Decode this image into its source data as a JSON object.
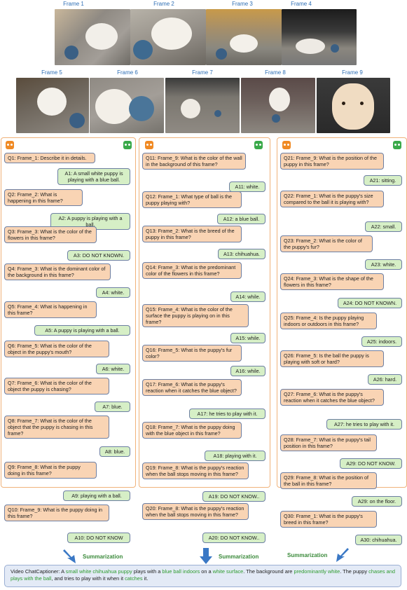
{
  "frames_top": [
    "Frame 1",
    "Frame 2",
    "Frame 3",
    "Frame 4"
  ],
  "frames_bottom": [
    "Frame 5",
    "Frame 6",
    "Frame 7",
    "Frame 8",
    "Frame 9"
  ],
  "col1": {
    "q": [
      "Q1: Frame_1: Describe it in details.",
      "Q2: Frame_2: What is happening in this frame?",
      "Q3: Frame_3: What is the color of the flowers in this frame?",
      "Q4: Frame_3: What is the dominant color of the background in this frame?",
      "Q5: Frame_4: What is happening in this frame?",
      "Q6: Frame_5: What is the color of the object in the puppy's mouth?",
      "Q7: Frame_6: What is the color of the object the puppy is chasing?",
      "Q8: Frame_7: What is the color of the object that the puppy is chasing in this frame?",
      "Q9: Frame_8: What is the puppy doing in this frame?",
      "Q10: Frame_9: What is the puppy doing in this frame?"
    ],
    "a": [
      "A1: A small white puppy is playing with a blue ball.",
      "A2: A puppy is playing with a ball.",
      "A3: DO NOT KNOWN.",
      "A4: white.",
      "A5: A puppy is playing with a ball.",
      "A6: white.",
      "A7:  blue.",
      "A8: blue.",
      "A9: playing with a ball.",
      "A10: DO NOT KNOW"
    ]
  },
  "col2": {
    "q": [
      "Q11: Frame_9: What is the color of the wall in the background of this frame?",
      "Q12: Frame_1: What type of ball is the puppy playing with?",
      "Q13: Frame_2: What is the breed of the puppy in this frame?",
      "Q14: Frame_3: What is the predominant color of the flowers in this frame?",
      "Q15: Frame_4: What is the color of the surface the puppy is playing on in this frame?",
      "Q16: Frame_5: What is the puppy's fur color?",
      "Q17: Frame_6: What is the puppy's reaction when it catches the blue object?",
      "Q18: Frame_7: What is the puppy doing with the blue object in this frame?",
      "Q19: Frame_8: What is the puppy's reaction when the ball stops moving in this frame?",
      "Q20: Frame_8: What is the puppy's reaction when the ball stops moving in this frame?"
    ],
    "a": [
      "A11: white.",
      "A12: a blue ball.",
      "A13: chihuahua.",
      "A14: while.",
      "A15: while.",
      "A16: while.",
      "A17: he tries to play with it.",
      "A18: playing with it.",
      "A19: DO NOT KNOW..",
      "A20: DO NOT KNOW.."
    ]
  },
  "col3": {
    "q": [
      "Q21: Frame_9: What is the position of the puppy in this frame?",
      "Q22: Frame_1: What is the puppy's size compared to the ball it is playing with?",
      "Q23: Frame_2: What is the color of the puppy's fur?",
      "Q24: Frame_3: What is the shape of the flowers in this frame?",
      "Q25: Frame_4: Is the puppy playing indoors or outdoors in this frame?",
      "Q26: Frame_5: Is the ball the puppy is playing with soft or hard?",
      "Q27: Frame_6: What is the puppy's reaction when it catches the blue object?",
      "Q28: Frame_7: What is the puppy's tail position in this frame?",
      "Q29: Frame_8: What is the position of the ball in this frame?",
      "Q30: Frame_1: What is the puppy's breed in this frame?"
    ],
    "a": [
      "A21: sitting.",
      "A22: small.",
      "A23: white.",
      "A24: DO NOT KNOWN.",
      "A25: indoors.",
      "A26: hard.",
      "A27: he tries to play with it.",
      "A29: DO NOT KNOW.",
      "A29: on the floor.",
      "A30: chihuahua."
    ]
  },
  "summarization_label": "Summarization",
  "summary": {
    "p1": "Video ChatCaptioner: A ",
    "g1": "small white chihuahua puppy",
    "p2": " plays with a ",
    "g2": "blue ball indoors",
    "p3": " on a ",
    "g3": "white surface",
    "p4": ". The background are ",
    "g4": "predominantly white",
    "p5": ". The puppy ",
    "g5": "chases and plays with the ball",
    "p6": ", and tries to play with it when it ",
    "g6": "catches",
    "p7": " it."
  },
  "colors": {
    "question_bg": "#f9d4b4",
    "answer_bg": "#d6efc6",
    "column_border": "#f0b27a",
    "arrow": "#3a78c5",
    "highlight": "#2e9b2e"
  }
}
